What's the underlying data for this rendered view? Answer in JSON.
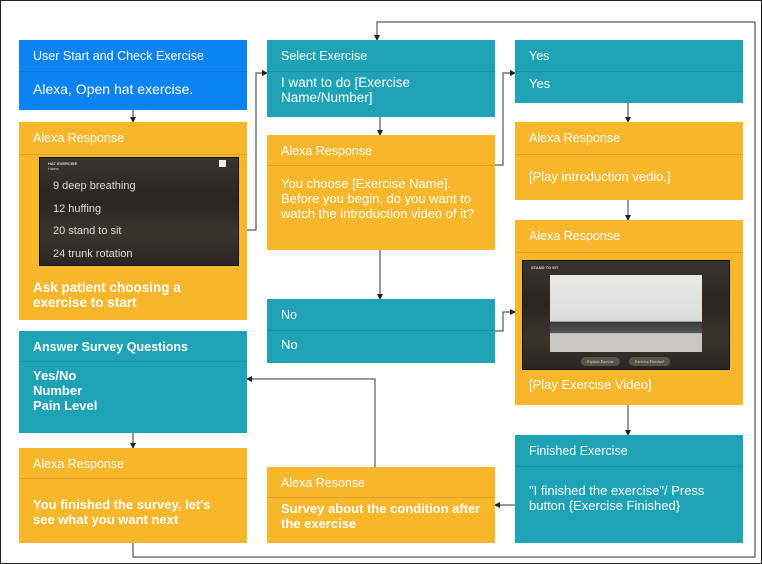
{
  "colors": {
    "user": "#0a84f3",
    "user_action": "#1ea3b6",
    "alexa": "#f8b62a"
  },
  "boxes": {
    "start": {
      "title": "User Start and Check Exercise",
      "body": "Alexa, Open hat exercise."
    },
    "resp_list": {
      "title": "Alexa Response",
      "body": "Ask patient choosing a exercise to start",
      "screen": {
        "header": "HAT EXERCISE",
        "sub": "Home",
        "items": [
          "9 deep breathing",
          "12 huffing",
          "20 stand to sit",
          "24 trunk rotation"
        ]
      }
    },
    "select": {
      "title": "Select Exercise",
      "body": "I want to do [Exercise Name/Number]"
    },
    "resp_choose": {
      "title": "Alexa Response",
      "body": "You choose [Exercise Name]. Before you begin, do you want to watch the introduction video of it?"
    },
    "no": {
      "title": "No",
      "body": "No"
    },
    "yes": {
      "title": "Yes",
      "body": "Yes"
    },
    "resp_intro": {
      "title": "Alexa Response",
      "body": "[Play introduction vedio.]"
    },
    "resp_video": {
      "title": "Alexa Response",
      "body": "[Play Exercise Video]",
      "screen": {
        "header": "STAND TO SIT",
        "buttons": [
          "Explain Exercise",
          "Exercise Finished"
        ]
      }
    },
    "finished": {
      "title": "Finished Exercise",
      "body": "\"I finished the exercise\"/ Press button {Exercise Finished}"
    },
    "resp_survey": {
      "title": "Alexa Resonse",
      "body": "Survey about the condition after the exercise"
    },
    "answer": {
      "title": "Answer Survey Questions",
      "lines": [
        "Yes/No",
        "Number",
        "Pain Level"
      ]
    },
    "resp_done": {
      "title": "Alexa Response",
      "body": "You finished the survey, let's see what you want next"
    }
  }
}
